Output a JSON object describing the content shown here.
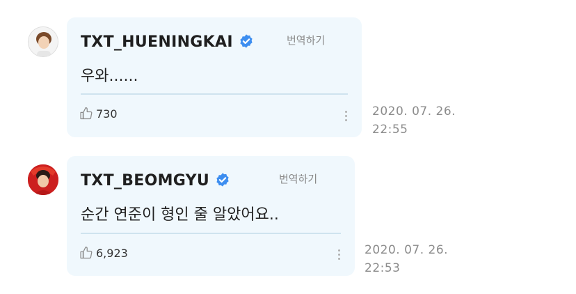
{
  "comments": [
    {
      "author": "TXT_HUENINGKAI",
      "translate_label": "번역하기",
      "text": "우와......",
      "likes": "730",
      "date": "2020. 07. 26.",
      "time": "22:55",
      "avatar_bg": "#f3f3f3"
    },
    {
      "author": "TXT_BEOMGYU",
      "translate_label": "번역하기",
      "text": "순간 연준이 형인 줄 알았어요..",
      "likes": "6,923",
      "date": "2020. 07. 26.",
      "time": "22:53",
      "avatar_bg": "#cc1f1f"
    }
  ],
  "colors": {
    "bubble": "#f0f8fd",
    "verified": "#3d8ef0",
    "divider": "#cfe3ef"
  }
}
